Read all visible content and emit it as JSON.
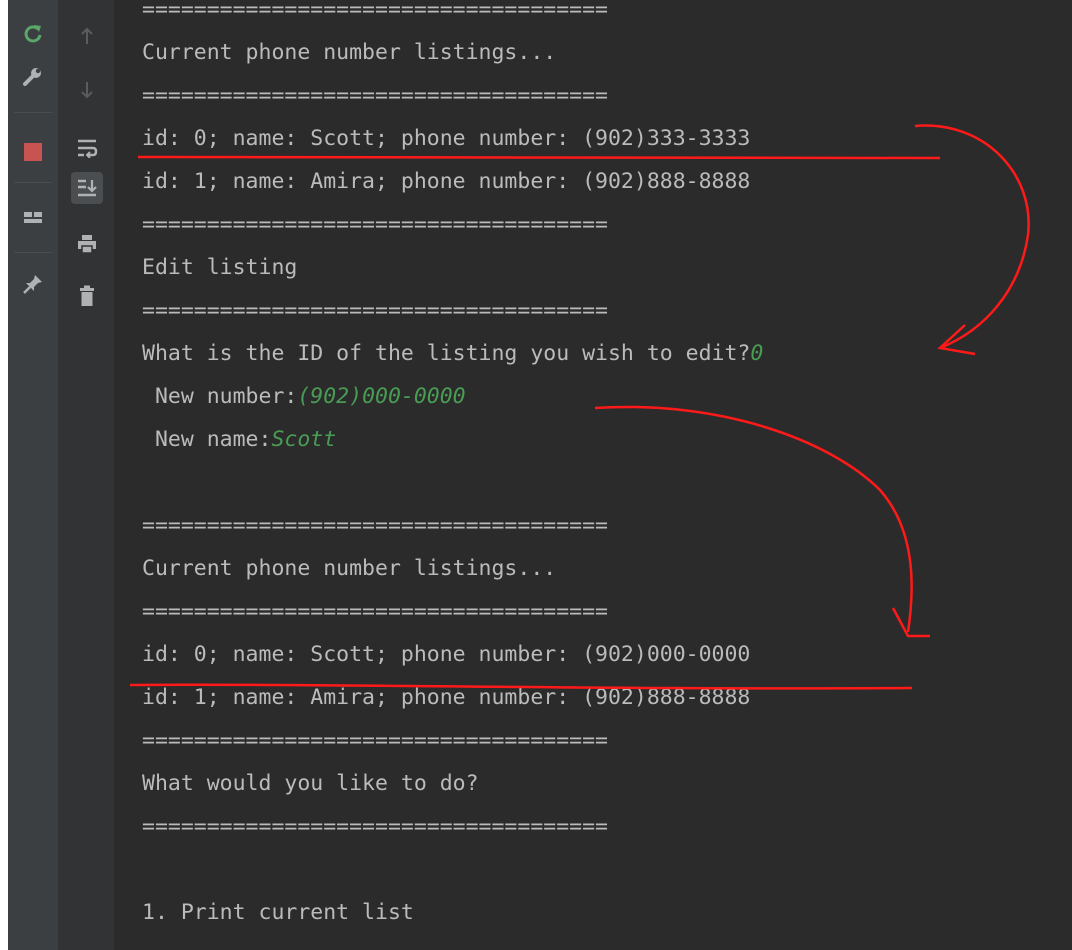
{
  "console": {
    "lines": [
      {
        "text": "====================================",
        "input": ""
      },
      {
        "text": "Current phone number listings...",
        "input": ""
      },
      {
        "text": "====================================",
        "input": ""
      },
      {
        "text": "id: 0; name: Scott; phone number: (902)333-3333",
        "input": ""
      },
      {
        "text": "id: 1; name: Amira; phone number: (902)888-8888",
        "input": ""
      },
      {
        "text": "====================================",
        "input": ""
      },
      {
        "text": "Edit listing",
        "input": ""
      },
      {
        "text": "====================================",
        "input": ""
      },
      {
        "text": "What is the ID of the listing you wish to edit?",
        "input": "0"
      },
      {
        "text": " New number:",
        "input": "(902)000-0000"
      },
      {
        "text": " New name:",
        "input": "Scott"
      },
      {
        "text": "",
        "input": ""
      },
      {
        "text": "====================================",
        "input": ""
      },
      {
        "text": "Current phone number listings...",
        "input": ""
      },
      {
        "text": "====================================",
        "input": ""
      },
      {
        "text": "id: 0; name: Scott; phone number: (902)000-0000",
        "input": ""
      },
      {
        "text": "id: 1; name: Amira; phone number: (902)888-8888",
        "input": ""
      },
      {
        "text": "====================================",
        "input": ""
      },
      {
        "text": "What would you like to do?",
        "input": ""
      },
      {
        "text": "====================================",
        "input": ""
      },
      {
        "text": "",
        "input": ""
      },
      {
        "text": "1. Print current list",
        "input": ""
      }
    ]
  },
  "toolbar_left": [
    {
      "name": "rerun-icon",
      "glyph": "↻",
      "color": "#59a869"
    },
    {
      "name": "wrench-icon",
      "glyph": "🔧",
      "color": "#afb1b3"
    },
    {
      "name": "stop-icon",
      "glyph": "■",
      "color": "#c75450"
    },
    {
      "name": "layout-icon",
      "glyph": "▬",
      "color": "#afb1b3"
    },
    {
      "name": "pin-icon",
      "glyph": "📌",
      "color": "#afb1b3"
    }
  ],
  "toolbar_right": [
    {
      "name": "up-arrow-icon",
      "glyph": "↑",
      "color": "#5a5d5f"
    },
    {
      "name": "down-arrow-icon",
      "glyph": "↓",
      "color": "#5a5d5f"
    },
    {
      "name": "soft-wrap-icon",
      "glyph": "⤶",
      "color": "#afb1b3"
    },
    {
      "name": "scroll-to-end-icon",
      "glyph": "⇊",
      "color": "#afb1b3"
    },
    {
      "name": "print-icon",
      "glyph": "⎙",
      "color": "#afb1b3"
    },
    {
      "name": "trash-icon",
      "glyph": "🗑",
      "color": "#afb1b3"
    }
  ],
  "colors": {
    "background": "#2b2b2b",
    "text": "#bbbbbb",
    "user_input": "#499c54",
    "annotation": "#ff0000"
  }
}
